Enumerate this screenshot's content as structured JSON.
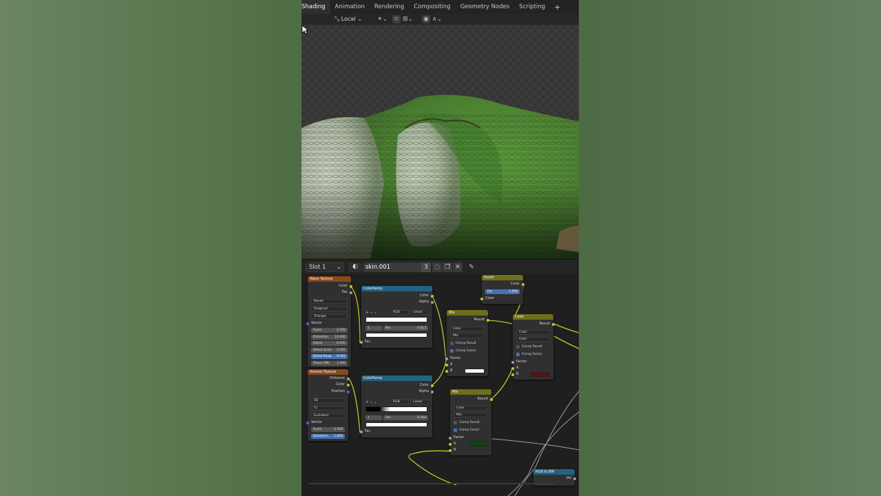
{
  "workspace_tabs": [
    {
      "label": "Shading",
      "active": true
    },
    {
      "label": "Animation",
      "active": false
    },
    {
      "label": "Rendering",
      "active": false
    },
    {
      "label": "Compositing",
      "active": false
    },
    {
      "label": "Geometry Nodes",
      "active": false
    },
    {
      "label": "Scripting",
      "active": false
    }
  ],
  "add_tab_label": "+",
  "viewport_header": {
    "orientation_label": "Local"
  },
  "node_header": {
    "slot_label": "Slot 1",
    "material_name": "skin.001",
    "user_count": "3"
  },
  "nodes": {
    "wave": {
      "title": "Wave Texture",
      "outputs": [
        "Color",
        "Fac"
      ],
      "dropdowns": [
        "Bands",
        "Diagonal",
        "Triangle"
      ],
      "vector_label": "Vector",
      "fields": [
        {
          "label": "Scale",
          "value": "2.250"
        },
        {
          "label": "Distortion",
          "value": "10.400"
        },
        {
          "label": "Detail",
          "value": "6.000"
        },
        {
          "label": "Detail Scale",
          "value": "0.350"
        },
        {
          "label": "Detail Roug.",
          "value": "0.562"
        },
        {
          "label": "Phase Offs.",
          "value": "1.400"
        }
      ]
    },
    "voronoi": {
      "title": "Voronoi Texture",
      "outputs": [
        "Distance",
        "Color",
        "Position"
      ],
      "dropdowns": [
        "2D",
        "F1",
        "Euclidean"
      ],
      "vector_label": "Vector",
      "fields": [
        {
          "label": "Scale",
          "value": "4.300"
        },
        {
          "label": "Randomn.",
          "value": "1.000"
        }
      ]
    },
    "ramp1": {
      "title": "ColorRamp",
      "outputs": [
        "Color",
        "Alpha"
      ],
      "mode": "RGB",
      "interp": "Linear",
      "stop_index": "1",
      "pos_label": "Pos",
      "pos_value": "0.023",
      "input": "Fac"
    },
    "ramp2": {
      "title": "ColorRamp",
      "outputs": [
        "Color",
        "Alpha"
      ],
      "mode": "RGB",
      "interp": "Linear",
      "stop_index": "1",
      "pos_label": "Pos",
      "pos_value": "0.364",
      "input": "Fac"
    },
    "invert": {
      "title": "Invert",
      "output": "Color",
      "fac_label": "Fac",
      "fac_value": "1.000",
      "input": "Color"
    },
    "mix1": {
      "title": "Mix",
      "output": "Result",
      "dropdowns": [
        "Color",
        "Mix"
      ],
      "clamp_result": "Clamp Result",
      "clamp_factor": "Clamp Factor",
      "inputs": [
        "Factor",
        "A",
        "B"
      ]
    },
    "mix2": {
      "title": "Mix",
      "output": "Result",
      "dropdowns": [
        "Color",
        "Mix"
      ],
      "clamp_result": "Clamp Result",
      "clamp_factor": "Clamp Factor",
      "inputs": [
        "Factor",
        "A",
        "B"
      ]
    },
    "color_mix": {
      "title": "Color",
      "output": "Result",
      "dropdowns": [
        "Color",
        "Color"
      ],
      "clamp_result": "Clamp Result",
      "clamp_factor": "Clamp Factor",
      "inputs": [
        "Factor",
        "A",
        "B"
      ]
    },
    "rgb_bw": {
      "title": "RGB to BW",
      "output": "Val"
    }
  },
  "colors": {
    "texture_header": "#8a4a1c",
    "converter_header": "#246283",
    "color_header": "#6e6e1d",
    "socket_yellow": "#c7c729",
    "mix1_b_swatch": "#ffffff",
    "mix2_b_swatch": "#0f4a0f",
    "color_b_swatch": "#6b0c0c"
  }
}
